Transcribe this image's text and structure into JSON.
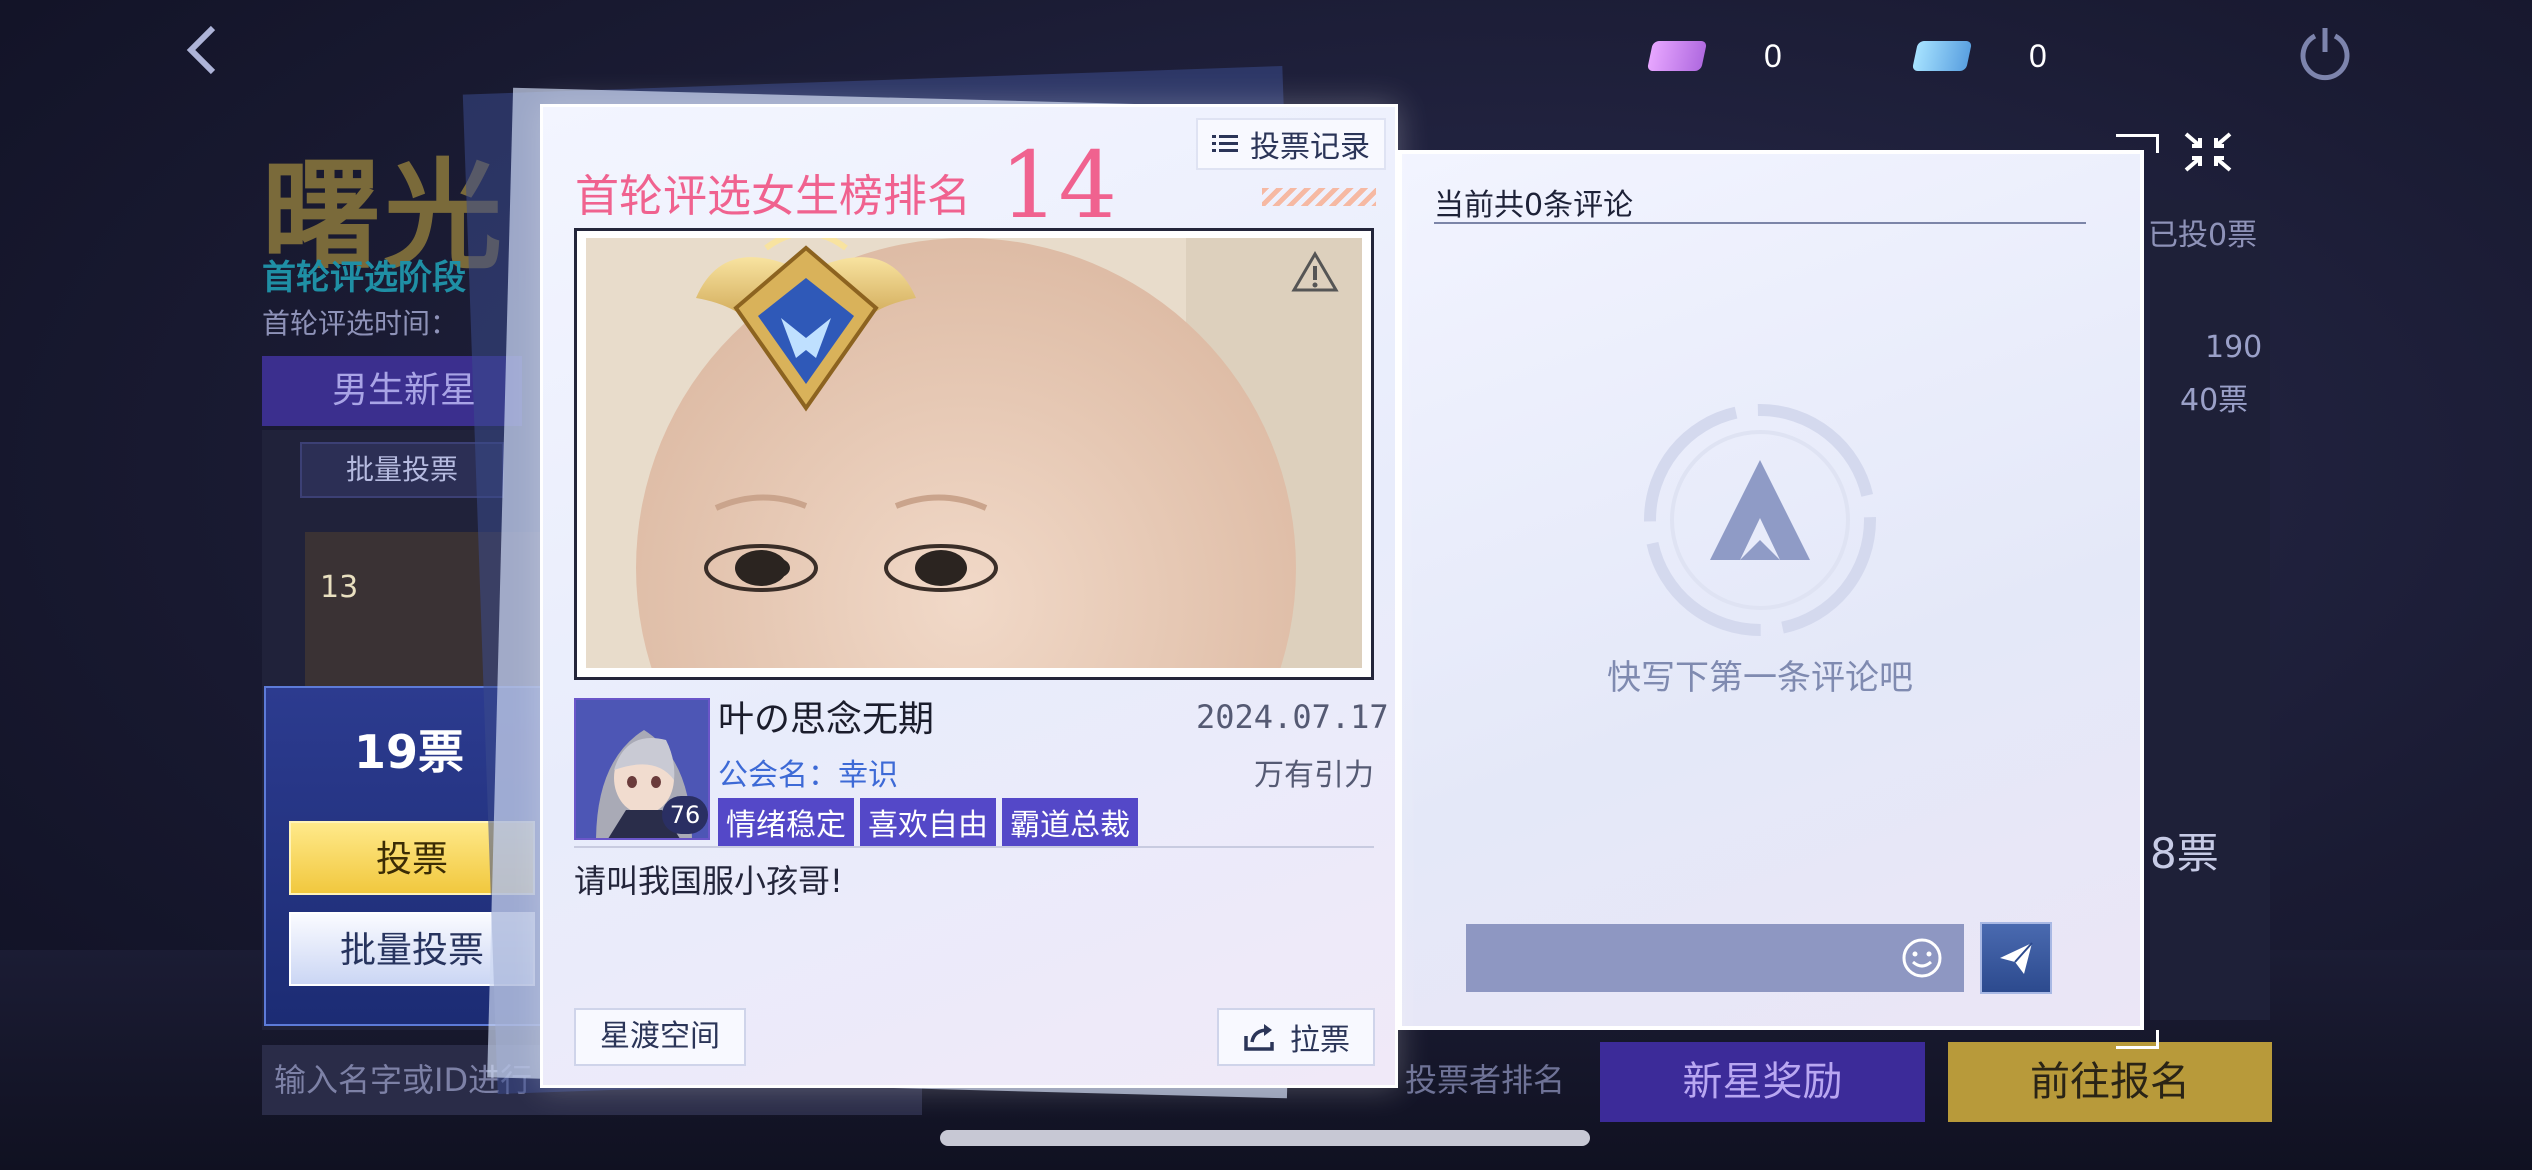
{
  "header": {
    "currency_pink": "0",
    "currency_blue": "0"
  },
  "background": {
    "title": "曙光",
    "stage": "首轮评选阶段",
    "time_label": "首轮评选时间：",
    "tab_male": "男生新星",
    "bulk_vote_small": "批量投票",
    "card_badge": "13",
    "search_placeholder": "输入名字或ID进行",
    "voted_text": "已投0票",
    "right_num_1": "190",
    "right_num_2": "40票",
    "right_num_3": "8票",
    "voter_rank": "投票者排名",
    "reward": "新星奖励",
    "signup": "前往报名"
  },
  "vote_panel": {
    "count": "19票",
    "vote": "投票",
    "bulk_vote": "批量投票"
  },
  "card": {
    "title": "首轮评选女生榜排名",
    "rank": "14",
    "record_button": "投票记录",
    "username": "叶の思念无期",
    "date": "2024.07.17",
    "guild": "公会名：幸识",
    "server": "万有引力",
    "level": "76",
    "tags": [
      "情绪稳定",
      "喜欢自由",
      "霸道总裁"
    ],
    "signature": "请叫我国服小孩哥!",
    "space_button": "星渡空间",
    "pull_button": "拉票"
  },
  "comments": {
    "count_text": "当前共0条评论",
    "empty_text": "快写下第一条评论吧",
    "input_value": ""
  },
  "icons": {
    "back": "back-arrow-icon",
    "power": "power-icon",
    "close": "collapse-icon",
    "send": "send-icon",
    "emoji": "emoji-icon",
    "warning": "warning-icon"
  },
  "colors": {
    "accent_pink": "#f0628f",
    "tag_purple": "#5448c8",
    "vote_gold": "#f1c83e"
  }
}
